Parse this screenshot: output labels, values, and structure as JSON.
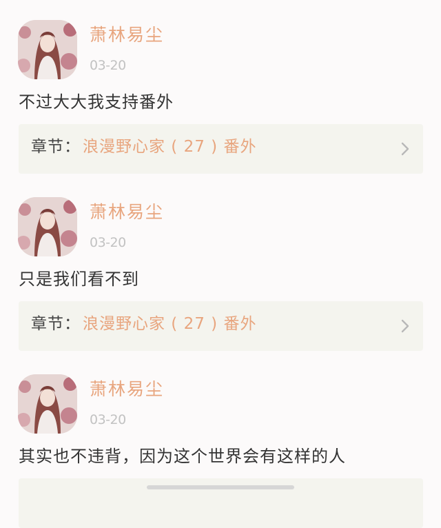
{
  "comments": [
    {
      "username": "萧林易尘",
      "date": "03-20",
      "text": "不过大大我支持番外",
      "chapter_prefix": "章节：",
      "chapter_name": "浪漫野心家 ( 27 ) 番外"
    },
    {
      "username": "萧林易尘",
      "date": "03-20",
      "text": "只是我们看不到",
      "chapter_prefix": "章节：",
      "chapter_name": "浪漫野心家 ( 27 ) 番外"
    },
    {
      "username": "萧林易尘",
      "date": "03-20",
      "text": "其实也不违背，因为这个世界会有这样的人"
    }
  ],
  "icons": {
    "avatar": "user-avatar-anime-girl",
    "chevron": "chevron-right-icon"
  },
  "colors": {
    "username": "#e8a57e",
    "chapter_bg": "#f4f4ee",
    "text": "#333333",
    "date": "#c2c2c2"
  }
}
